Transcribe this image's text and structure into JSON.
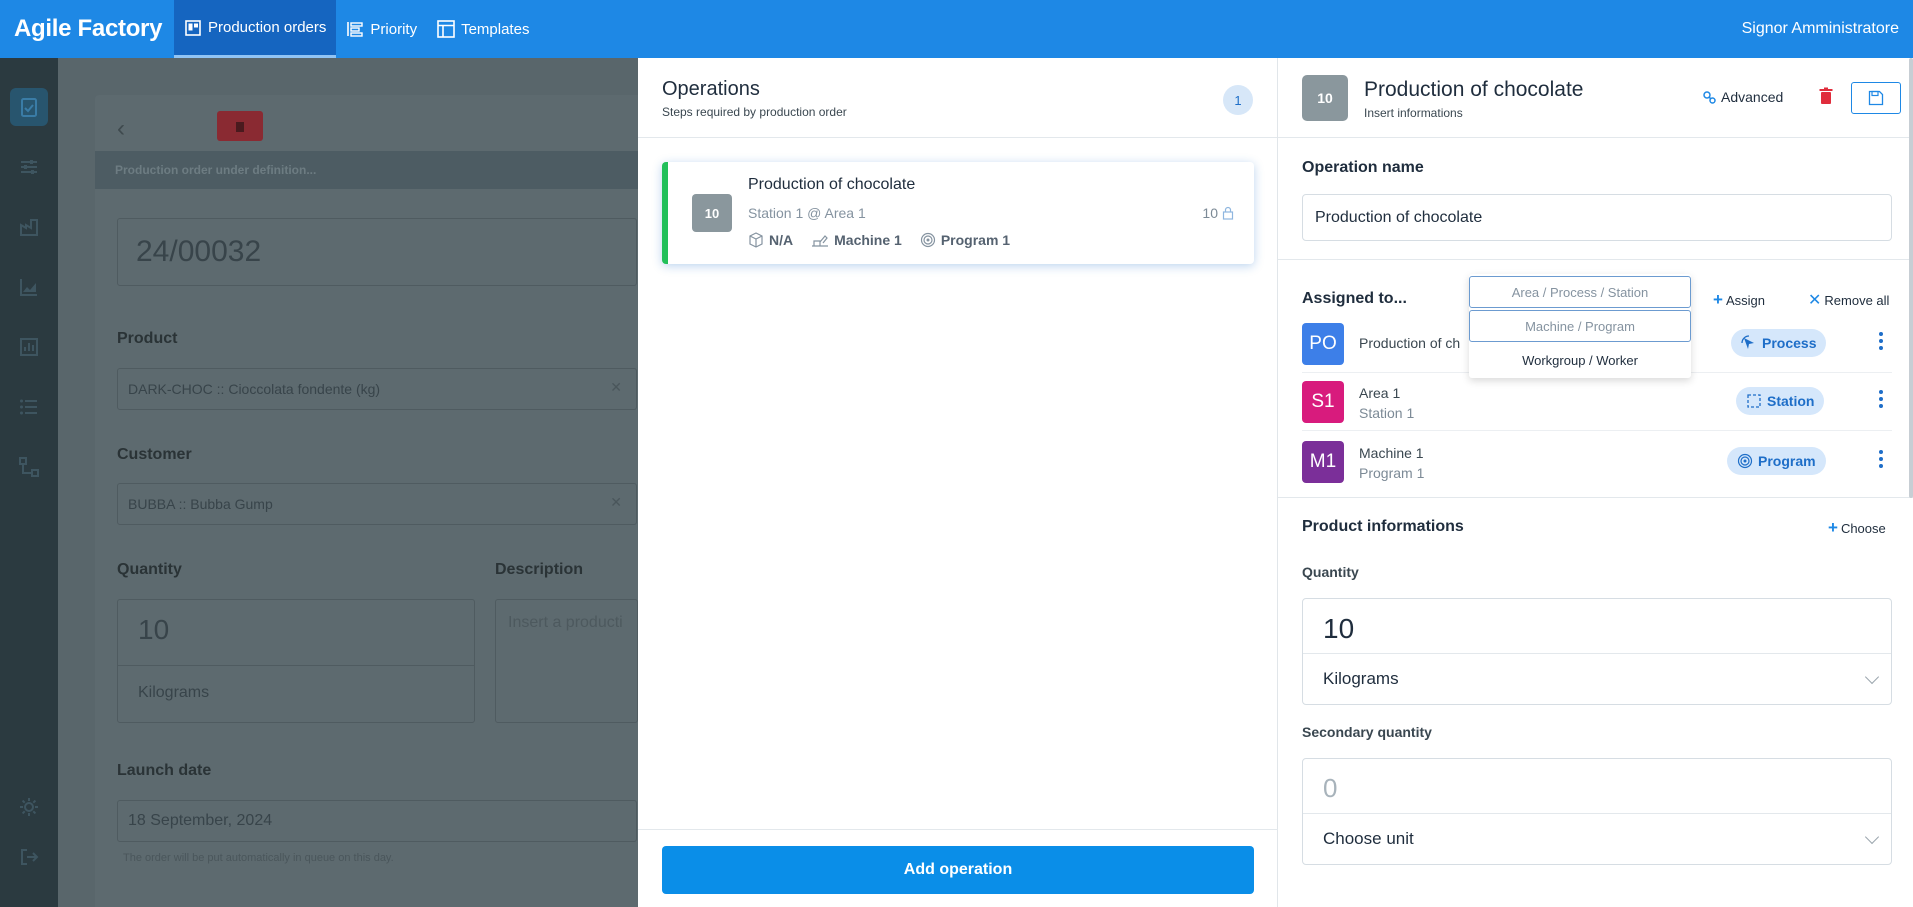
{
  "app": {
    "brand": "Agile Factory",
    "nav": [
      {
        "label": "Production orders",
        "icon": "kanban-board-icon",
        "active": true
      },
      {
        "label": "Priority",
        "icon": "priority-list-icon",
        "active": false
      },
      {
        "label": "Templates",
        "icon": "template-icon",
        "active": false
      }
    ],
    "user": "Signor Amministratore"
  },
  "background_form": {
    "status": "Production order under definition...",
    "order_number": "24/00032",
    "product_label": "Product",
    "product_value": "DARK-CHOC :: Cioccolata fondente (kg)",
    "customer_label": "Customer",
    "customer_value": "BUBBA :: Bubba Gump",
    "quantity_label": "Quantity",
    "quantity_value": "10",
    "quantity_unit": "Kilograms",
    "description_label": "Description",
    "description_placeholder": "Insert a producti",
    "launch_label": "Launch date",
    "launch_value": "18 September, 2024",
    "launch_note": "The order will be put automatically in queue on this day."
  },
  "operations": {
    "title": "Operations",
    "subtitle": "Steps required by production order",
    "count": "1",
    "items": [
      {
        "badge": "10",
        "name": "Production of chocolate",
        "location": "Station 1 @ Area 1",
        "product": "N/A",
        "machine": "Machine 1",
        "program": "Program 1",
        "qty": "10"
      }
    ],
    "add_label": "Add operation"
  },
  "detail": {
    "badge": "10",
    "title": "Production of chocolate",
    "subtitle": "Insert informations",
    "advanced_label": "Advanced",
    "operation_name_label": "Operation name",
    "operation_name_value": "Production of chocolate",
    "assigned_label": "Assigned to...",
    "assign_label": "Assign",
    "remove_all_label": "Remove all",
    "assign_menu": [
      "Area / Process / Station",
      "Machine / Program",
      "Workgroup / Worker"
    ],
    "assignments": [
      {
        "initials": "PO",
        "color": "#3d7fe8",
        "name": "Production of ch",
        "sub": "",
        "tag": "Process",
        "tag_icon": "process-icon"
      },
      {
        "initials": "S1",
        "color": "#d81b7d",
        "name": "Area 1",
        "sub": "Station 1",
        "tag": "Station",
        "tag_icon": "station-icon"
      },
      {
        "initials": "M1",
        "color": "#7b2f99",
        "name": "Machine 1",
        "sub": "Program 1",
        "tag": "Program",
        "tag_icon": "program-icon"
      }
    ],
    "product_info_label": "Product informations",
    "choose_label": "Choose",
    "quantity_label": "Quantity",
    "quantity_value": "10",
    "quantity_unit": "Kilograms",
    "secondary_label": "Secondary quantity",
    "secondary_placeholder": "0",
    "secondary_unit": "Choose unit"
  },
  "colors": {
    "topbar": "#1e88e5",
    "accent": "#0a8ee8",
    "success": "#22c05a",
    "danger": "#e02d3c"
  }
}
